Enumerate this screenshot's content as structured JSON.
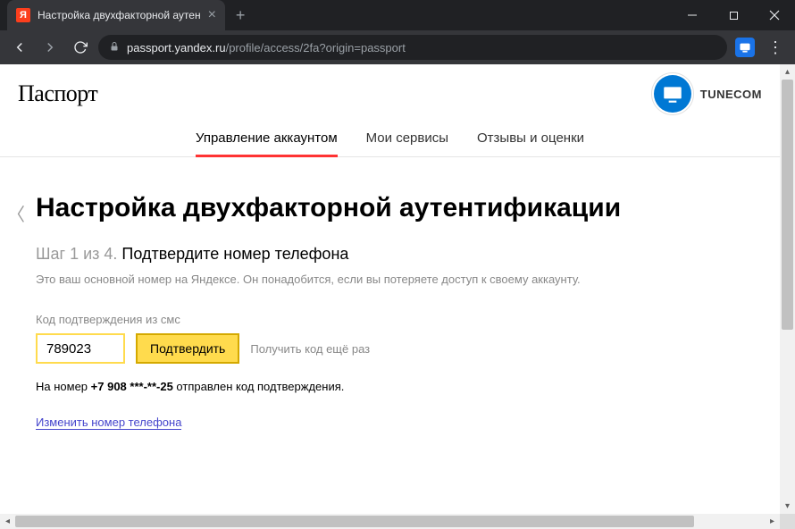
{
  "browser": {
    "tab_title": "Настройка двухфакторной аутен",
    "url_host": "passport.yandex.ru",
    "url_path": "/profile/access/2fa?origin=passport",
    "favicon_letter": "Я"
  },
  "header": {
    "brand": "Паспорт",
    "username": "TUNECOM"
  },
  "tabs": {
    "items": [
      {
        "label": "Управление аккаунтом",
        "active": true
      },
      {
        "label": "Мои сервисы",
        "active": false
      },
      {
        "label": "Отзывы и оценки",
        "active": false
      }
    ]
  },
  "main": {
    "title": "Настройка двухфакторной аутентификации",
    "step_prefix": "Шаг 1 из 4.",
    "step_title": "Подтвердите номер телефона",
    "description": "Это ваш основной номер на Яндексе. Он понадобится, если вы потеряете доступ к своему аккаунту.",
    "field_label": "Код подтверждения из смс",
    "code_value": "789023",
    "confirm_label": "Подтвердить",
    "resend_label": "Получить код ещё раз",
    "sent_prefix": "На номер ",
    "sent_number": "+7 908 ***-**-25",
    "sent_suffix": " отправлен код подтверждения.",
    "change_link": "Изменить номер телефона"
  }
}
